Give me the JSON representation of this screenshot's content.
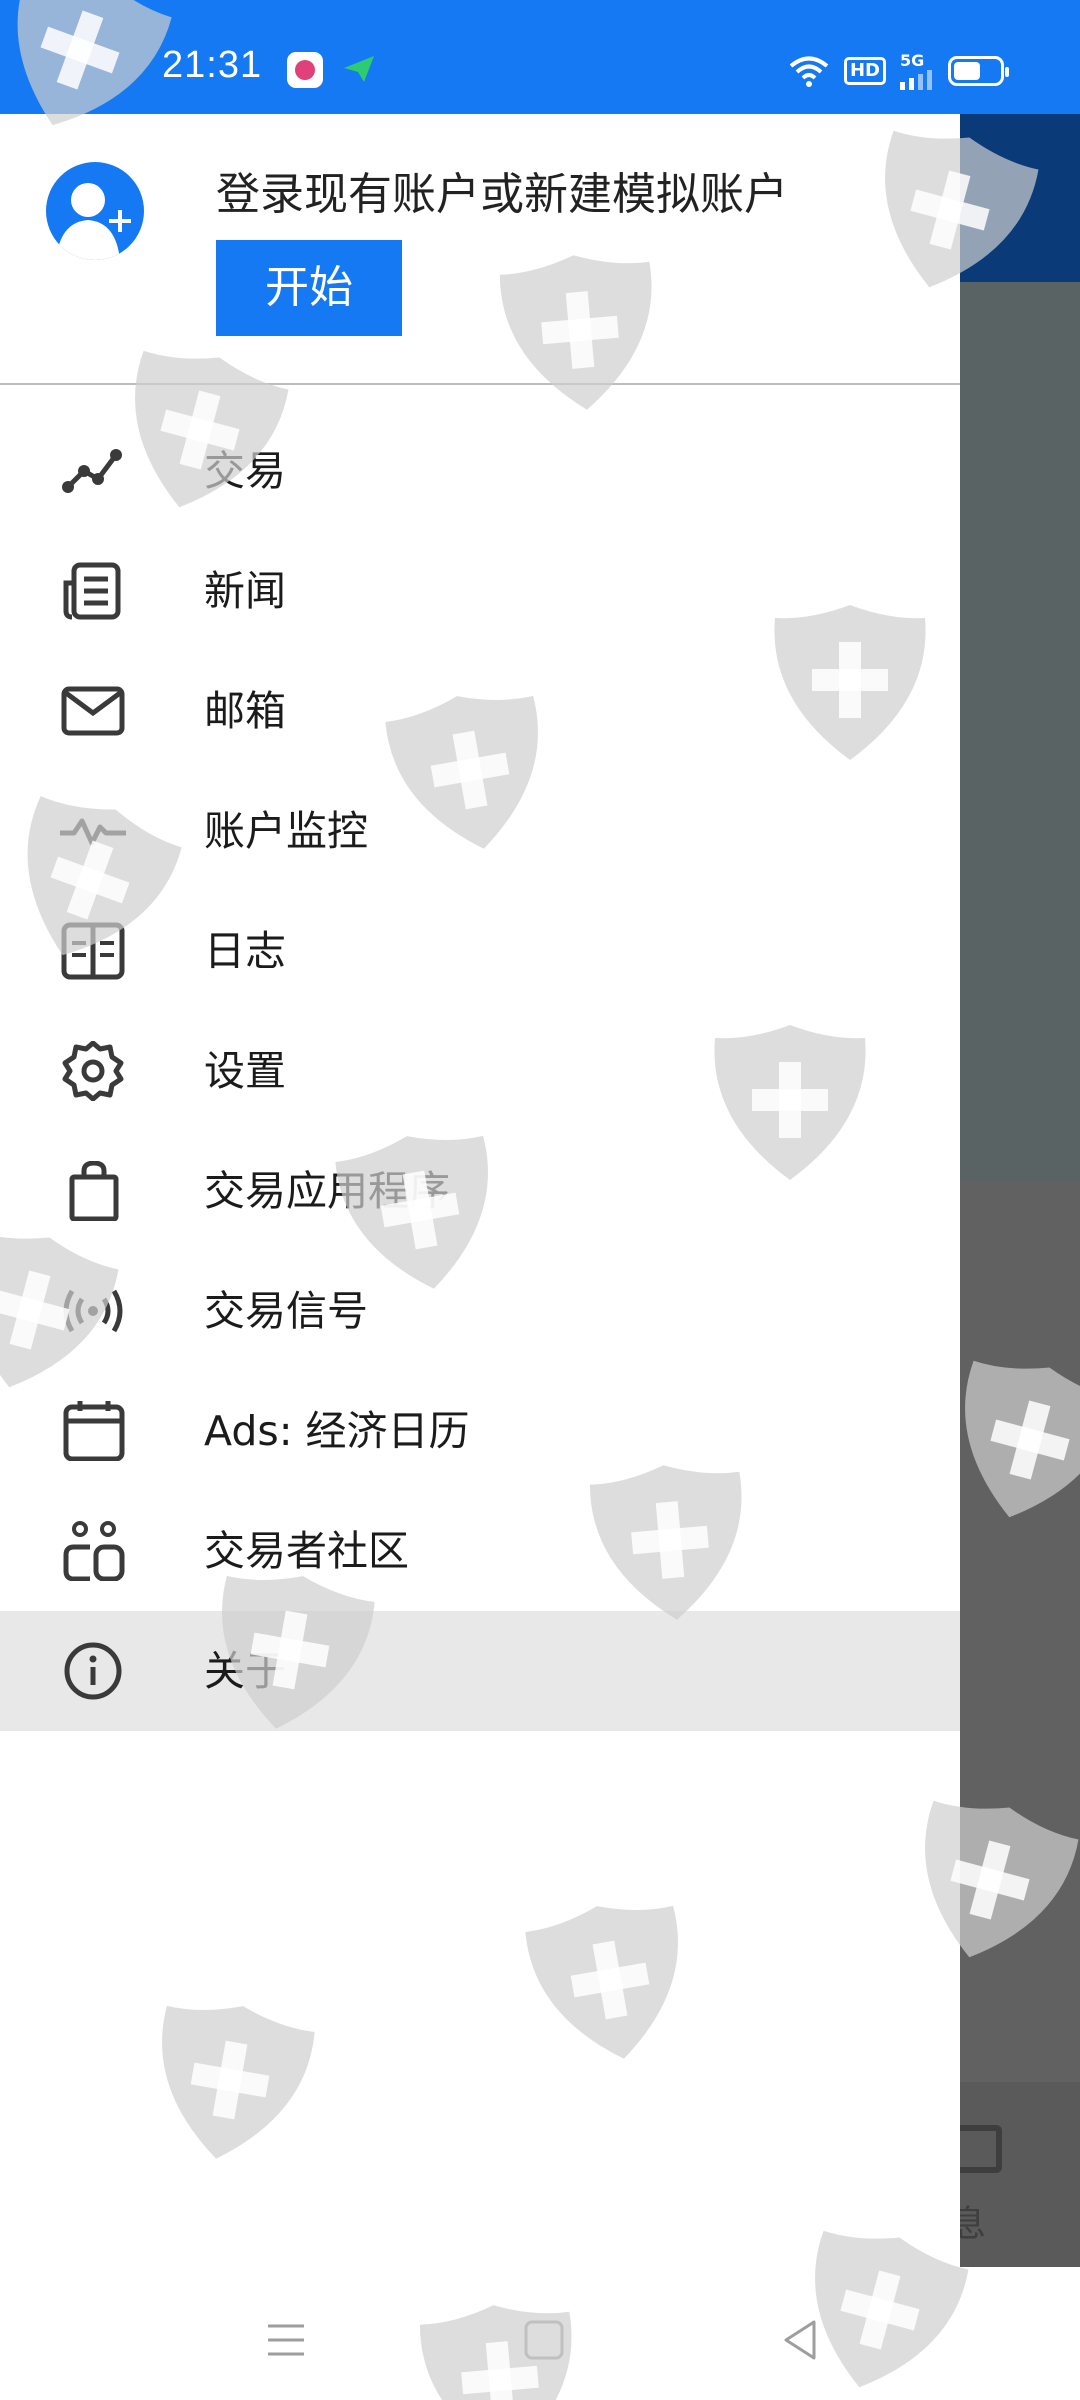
{
  "status_bar": {
    "time": "21:31",
    "badges": [
      "HD",
      "5G"
    ]
  },
  "drawer": {
    "signin_prompt": "登录现有账户或新建模拟账户",
    "start_label": "开始",
    "menu": [
      {
        "label": "交易",
        "icon": "trade-chart-icon"
      },
      {
        "label": "新闻",
        "icon": "news-icon"
      },
      {
        "label": "邮箱",
        "icon": "mail-icon"
      },
      {
        "label": "账户监控",
        "icon": "pulse-icon"
      },
      {
        "label": "日志",
        "icon": "journal-icon"
      },
      {
        "label": "设置",
        "icon": "gear-icon"
      },
      {
        "label": "交易应用程序",
        "icon": "shopping-bag-icon"
      },
      {
        "label": "交易信号",
        "icon": "signal-broadcast-icon"
      },
      {
        "label": "Ads: 经济日历",
        "icon": "calendar-icon"
      },
      {
        "label": "交易者社区",
        "icon": "community-icon"
      },
      {
        "label": "关于",
        "icon": "info-icon",
        "selected": true
      }
    ]
  },
  "background_app": {
    "tab_label": "息"
  },
  "colors": {
    "accent": "#1479f2",
    "icon": "#3a3a3a",
    "selected_row": "#e8e8e8"
  }
}
